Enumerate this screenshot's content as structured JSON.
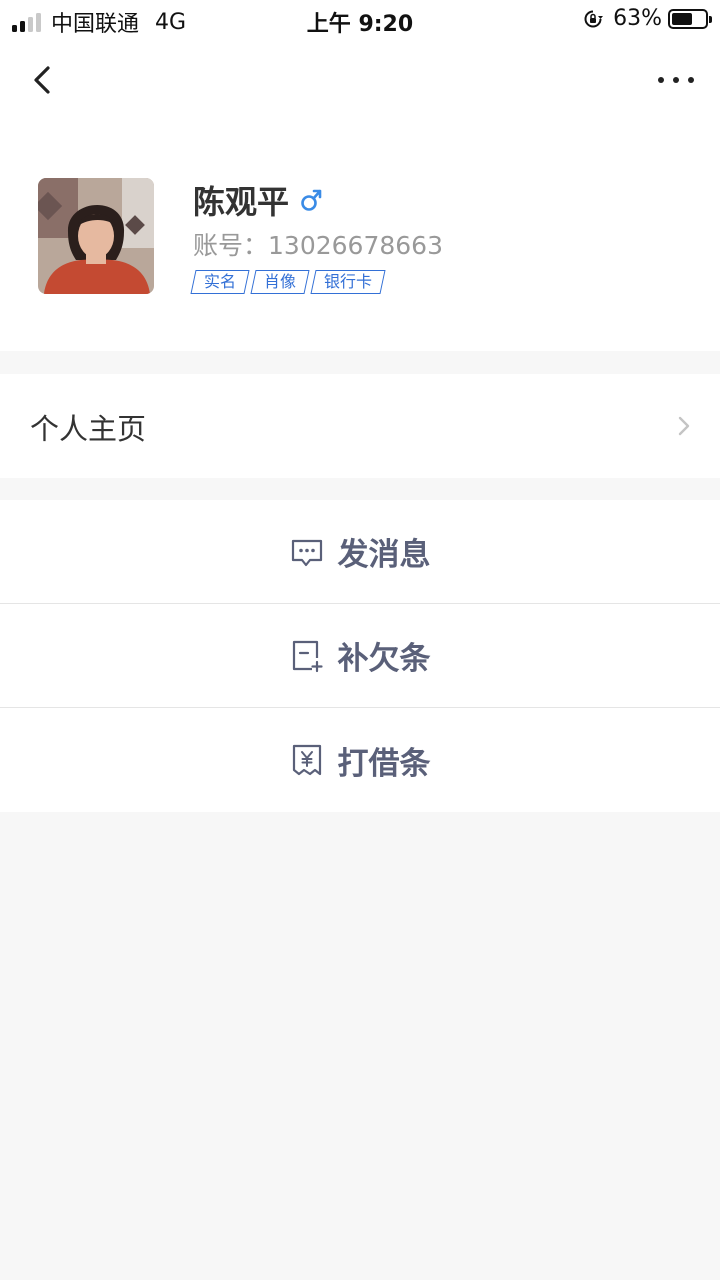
{
  "status_bar": {
    "carrier": "中国联通",
    "network": "4G",
    "time": "上午 9:20",
    "battery": "63%",
    "battery_level": 0.63
  },
  "profile": {
    "name": "陈观平",
    "gender_symbol": "♂",
    "account_label": "账号：",
    "account_value": "13026678663",
    "tags": [
      "实名",
      "肖像",
      "银行卡"
    ]
  },
  "list": {
    "home_label": "个人主页"
  },
  "actions": [
    {
      "label": "发消息",
      "icon": "message-icon"
    },
    {
      "label": "补欠条",
      "icon": "iou-add-icon"
    },
    {
      "label": "打借条",
      "icon": "loan-note-icon"
    }
  ],
  "colors": {
    "accent": "#3370d6",
    "action_text": "#5a6079",
    "background": "#f7f7f7"
  }
}
